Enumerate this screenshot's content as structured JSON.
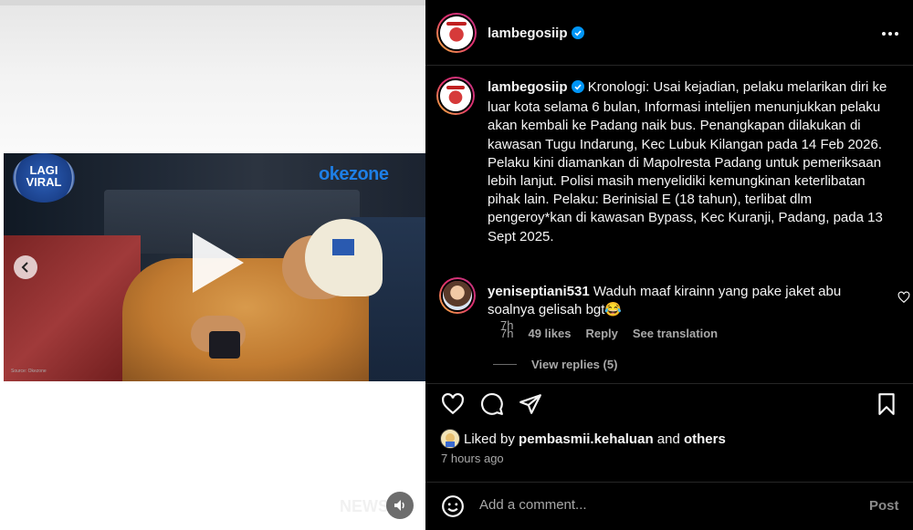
{
  "media": {
    "video_overlay_logo_text": "LAGI VIRAL",
    "channel_watermark": "okezone",
    "source_credit": "Source: Okezone",
    "bottom_watermark": "NEWS",
    "icons": {
      "play": "play-icon",
      "prev": "chevron-left-icon",
      "mute": "speaker-icon"
    }
  },
  "header": {
    "username": "lambegosiip",
    "verified": true,
    "more_icon": "more-horizontal-icon"
  },
  "caption": {
    "username": "lambegosiip",
    "text": "Kronologi: Usai kejadian, pelaku melarikan diri ke luar kota selama 6 bulan, Informasi intelijen menunjukkan pelaku akan kembali ke Padang naik bus. Penangkapan dilakukan di kawasan Tugu Indarung, Kec Lubuk Kilangan pada 14 Feb 2026. Pelaku kini diamankan di Mapolresta Padang untuk pemeriksaan lebih lanjut. Polisi masih menyelidiki kemungkinan keterlibatan pihak lain. Pelaku: Berinisial E (18 tahun), terlibat dlm pengeroy*kan di kawasan Bypass, Kec Kuranji, Padang, pada 13 Sept 2025.",
    "time": "7h"
  },
  "comment": {
    "username": "yeniseptiani531",
    "text": "Waduh maaf kirainn yang pake jaket abu soalnya gelisah bgt😂",
    "time": "7h",
    "likes": "49 likes",
    "reply_label": "Reply",
    "translate_label": "See translation",
    "view_replies": "View replies (5)"
  },
  "actions": {
    "like_icon": "heart-icon",
    "comment_icon": "comment-icon",
    "share_icon": "send-icon",
    "save_icon": "bookmark-icon"
  },
  "likes": {
    "prefix": "Liked by",
    "user": "pembasmii.kehaluan",
    "connector": "and",
    "others": "others"
  },
  "posted_time": "7 hours ago",
  "add_comment": {
    "placeholder": "Add a comment...",
    "post_label": "Post"
  },
  "colors": {
    "background": "#000000",
    "text_primary": "#f5f5f5",
    "text_secondary": "#a8a8a8",
    "verified_blue": "#0095f6",
    "divider": "#262626"
  }
}
